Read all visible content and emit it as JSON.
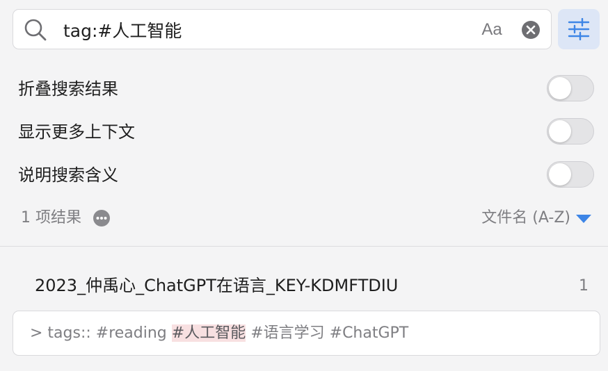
{
  "search": {
    "query": "tag:#人工智能",
    "case_label": "Aa"
  },
  "options": [
    {
      "label": "折叠搜索结果",
      "enabled": false
    },
    {
      "label": "显示更多上下文",
      "enabled": false
    },
    {
      "label": "说明搜索含义",
      "enabled": false
    }
  ],
  "results": {
    "count_label": "1 项结果",
    "sort_label": "文件名 (A-Z)"
  },
  "file": {
    "name": "2023_仲禹心_ChatGPT在语言_KEY-KDMFTDIU",
    "match_count": "1"
  },
  "snippet": {
    "before": "> tags:: #reading ",
    "match": "#人工智能",
    "after": " #语言学习 #ChatGPT"
  },
  "colors": {
    "accent": "#3d85e6",
    "filter_bg": "#dde6f6",
    "highlight_bg": "#f8e0e1"
  },
  "icons": {
    "search": "search-icon",
    "clear": "clear-circle-icon",
    "filter": "sliders-icon",
    "more": "ellipsis-circle-icon",
    "sort": "triangle-down-icon"
  }
}
